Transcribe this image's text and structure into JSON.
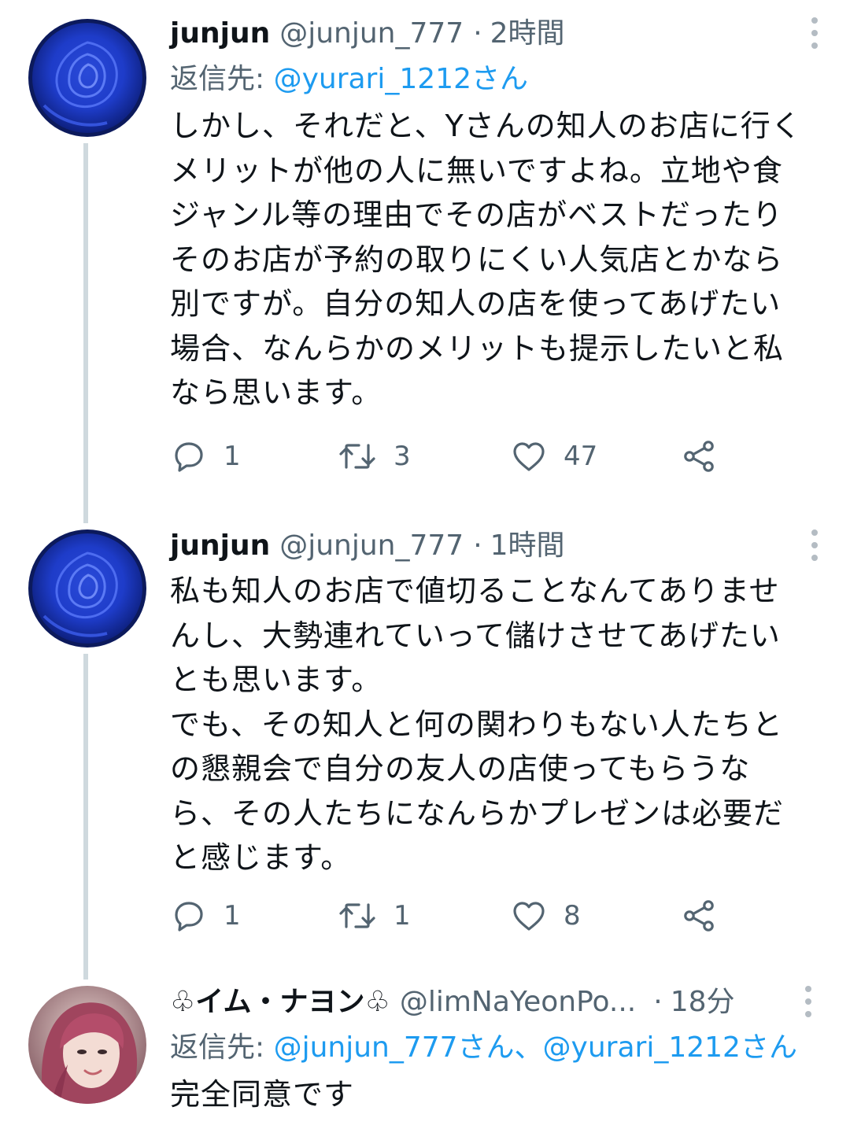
{
  "tweets": [
    {
      "name": "junjun",
      "handle": "@junjun_777",
      "separator": "·",
      "time": "2時間",
      "reply_prefix": "返信先: ",
      "reply_mentions": "@yurari_1212さん",
      "text": "しかし、それだと、Yさんの知人のお店に行く\nメリットが他の人に無いですよね。立地や食\nジャンル等の理由でその店がベストだったり\nそのお店が予約の取りにくい人気店とかなら\n別ですが。自分の知人の店を使ってあげたい\n場合、なんらかのメリットも提示したいと私\nなら思います。",
      "counts": {
        "replies": "1",
        "retweets": "3",
        "likes": "47"
      },
      "avatar_icon": "blue-rose-avatar"
    },
    {
      "name": "junjun",
      "handle": "@junjun_777",
      "separator": "·",
      "time": "1時間",
      "text": "私も知人のお店で値切ることなんてありませ\nんし、大勢連れていって儲けさせてあげたい\nとも思います。\nでも、その知人と何の関わりもない人たちと\nの懇親会で自分の友人の店使ってもらうな\nら、その人たちになんらかプレゼンは必要だ\nと感じます。",
      "counts": {
        "replies": "1",
        "retweets": "1",
        "likes": "8"
      },
      "avatar_icon": "blue-rose-avatar"
    },
    {
      "name": "♧イム・ナヨン♧",
      "handle": "@limNaYeonPo...",
      "separator": "·",
      "time": "18分",
      "reply_prefix": "返信先: ",
      "reply_mentions": "@junjun_777さん、@yurari_1212さん",
      "text": "完全同意です",
      "avatar_icon": "person-photo-avatar"
    }
  ],
  "colors": {
    "mention": "#1d9bf0",
    "secondary_text": "#536471",
    "thread_line": "#cfd9de",
    "icon": "#536471"
  },
  "icons": [
    "reply-icon",
    "retweet-icon",
    "like-icon",
    "share-icon",
    "more-icon"
  ]
}
